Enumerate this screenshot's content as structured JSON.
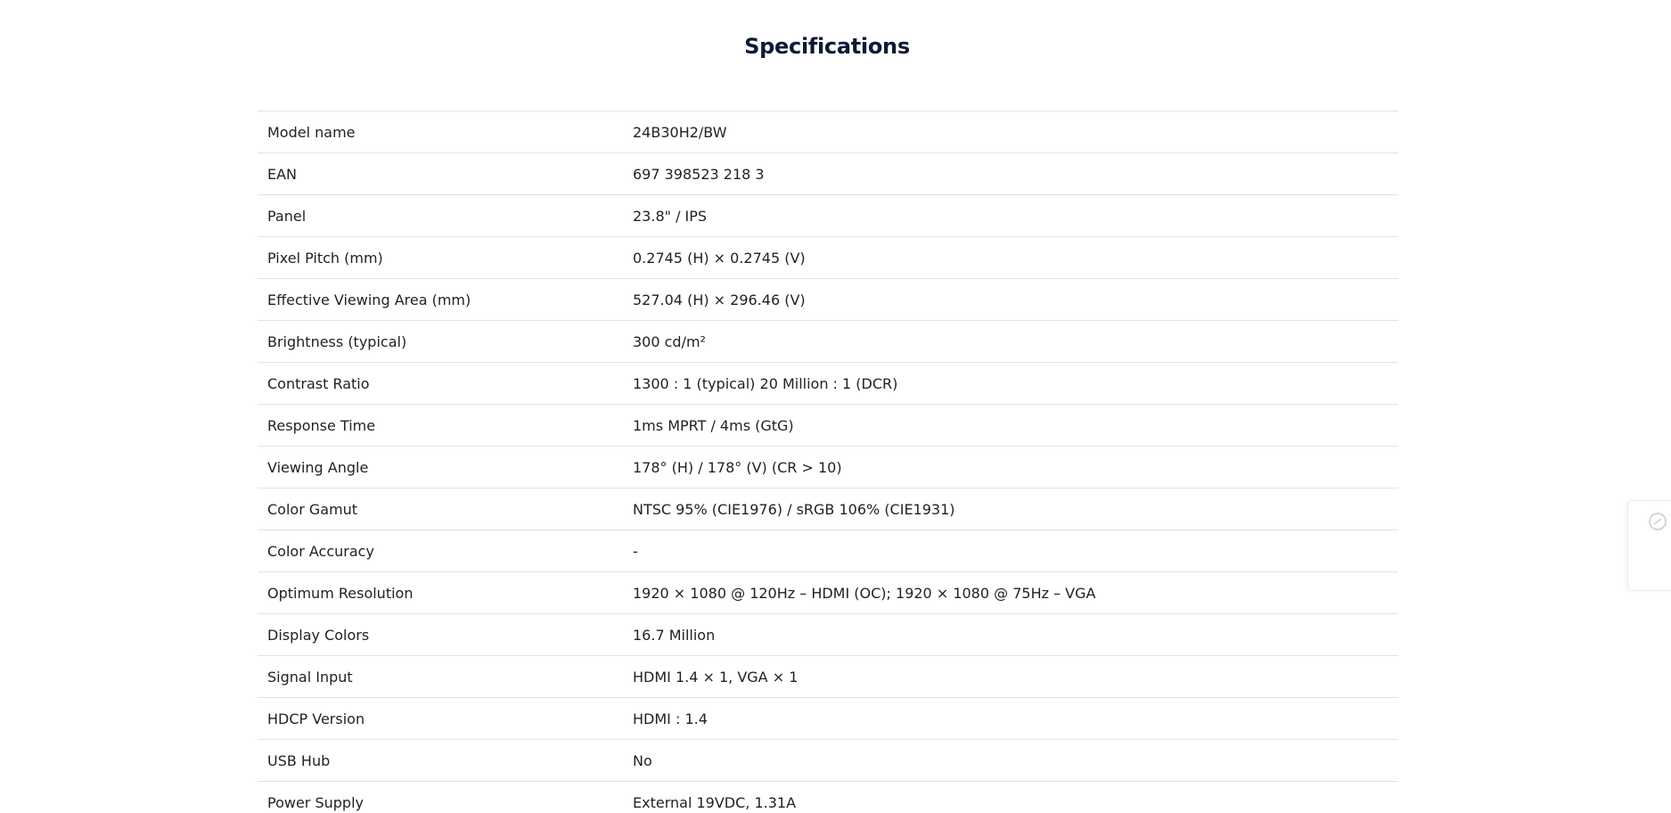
{
  "page": {
    "title": "Specifications"
  },
  "specs": [
    {
      "label": "Model name",
      "value": "24B30H2/BW"
    },
    {
      "label": "EAN",
      "value": "697 398523 218 3"
    },
    {
      "label": "Panel",
      "value": "23.8\" / IPS"
    },
    {
      "label": "Pixel Pitch (mm)",
      "value": "0.2745 (H) × 0.2745 (V)"
    },
    {
      "label": "Effective Viewing Area (mm)",
      "value": "527.04 (H) × 296.46 (V)"
    },
    {
      "label": "Brightness (typical)",
      "value": "300 cd/m²"
    },
    {
      "label": "Contrast Ratio",
      "value": "1300 : 1 (typical) 20 Million : 1 (DCR)"
    },
    {
      "label": "Response Time",
      "value": "1ms MPRT / 4ms (GtG)"
    },
    {
      "label": "Viewing Angle",
      "value": "178° (H) / 178° (V) (CR > 10)"
    },
    {
      "label": "Color Gamut",
      "value": "NTSC 95% (CIE1976) / sRGB 106% (CIE1931)"
    },
    {
      "label": "Color Accuracy",
      "value": "-"
    },
    {
      "label": "Optimum Resolution",
      "value": "1920 × 1080 @ 120Hz – HDMI (OC); 1920 × 1080 @ 75Hz – VGA"
    },
    {
      "label": "Display Colors",
      "value": "16.7 Million"
    },
    {
      "label": "Signal Input",
      "value": "HDMI 1.4 × 1, VGA × 1"
    },
    {
      "label": "HDCP Version",
      "value": "HDMI : 1.4"
    },
    {
      "label": "USB Hub",
      "value": "No"
    },
    {
      "label": "Power Supply",
      "value": "External 19VDC, 1.31A"
    }
  ],
  "side_widget": {
    "icon": "chat-icon"
  },
  "colors": {
    "title": "#101935",
    "text": "#222222",
    "divider": "#e2e2e2",
    "background": "#ffffff"
  }
}
